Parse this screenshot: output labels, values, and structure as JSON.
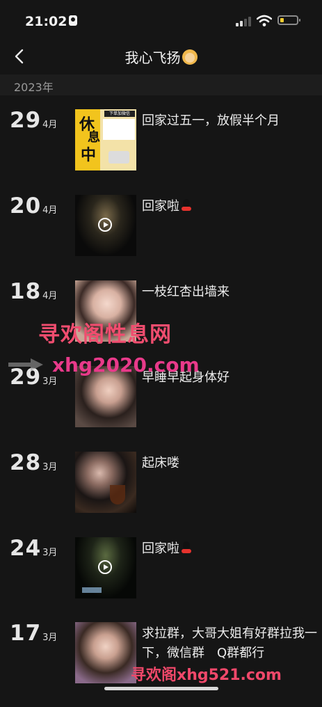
{
  "status_bar": {
    "time": "21:02"
  },
  "header": {
    "title": "我心飞扬"
  },
  "year_label": "2023年",
  "entries": [
    {
      "day": "29",
      "month": "4月",
      "text": "回家过五一，放假半个月",
      "thumb": "rest-sign-poster",
      "video": false,
      "qq_icon": false,
      "poster": {
        "line1": "休",
        "line2": "息",
        "line3": "中",
        "small": "下单加微信"
      }
    },
    {
      "day": "20",
      "month": "4月",
      "text": "回家啦",
      "thumb": "night-road-video",
      "video": true,
      "qq_icon": true
    },
    {
      "day": "18",
      "month": "4月",
      "text": "一枝红杏出墙来",
      "thumb": "selfie-photo",
      "video": false,
      "qq_icon": false
    },
    {
      "day": "29",
      "month": "3月",
      "text": "早睡早起身体好",
      "thumb": "selfie-photo",
      "video": false,
      "qq_icon": false
    },
    {
      "day": "28",
      "month": "3月",
      "text": "起床喽",
      "thumb": "wine-glass-photo",
      "video": false,
      "qq_icon": false
    },
    {
      "day": "24",
      "month": "3月",
      "text": "回家啦",
      "thumb": "night-road-video",
      "video": true,
      "qq_icon": true
    },
    {
      "day": "17",
      "month": "3月",
      "text": "求拉群，大哥大姐有好群拉我一下，微信群　Q群都行",
      "thumb": "selfie-photo",
      "video": false,
      "qq_icon": false
    }
  ],
  "watermarks": {
    "line1": "寻欢阁性息网",
    "line2": "xhg2020.com",
    "line3": "寻欢阁xhg521.com"
  },
  "colors": {
    "background": "#151515",
    "watermark_pink": "#f04d6f",
    "battery_fill": "#f2cc30"
  }
}
